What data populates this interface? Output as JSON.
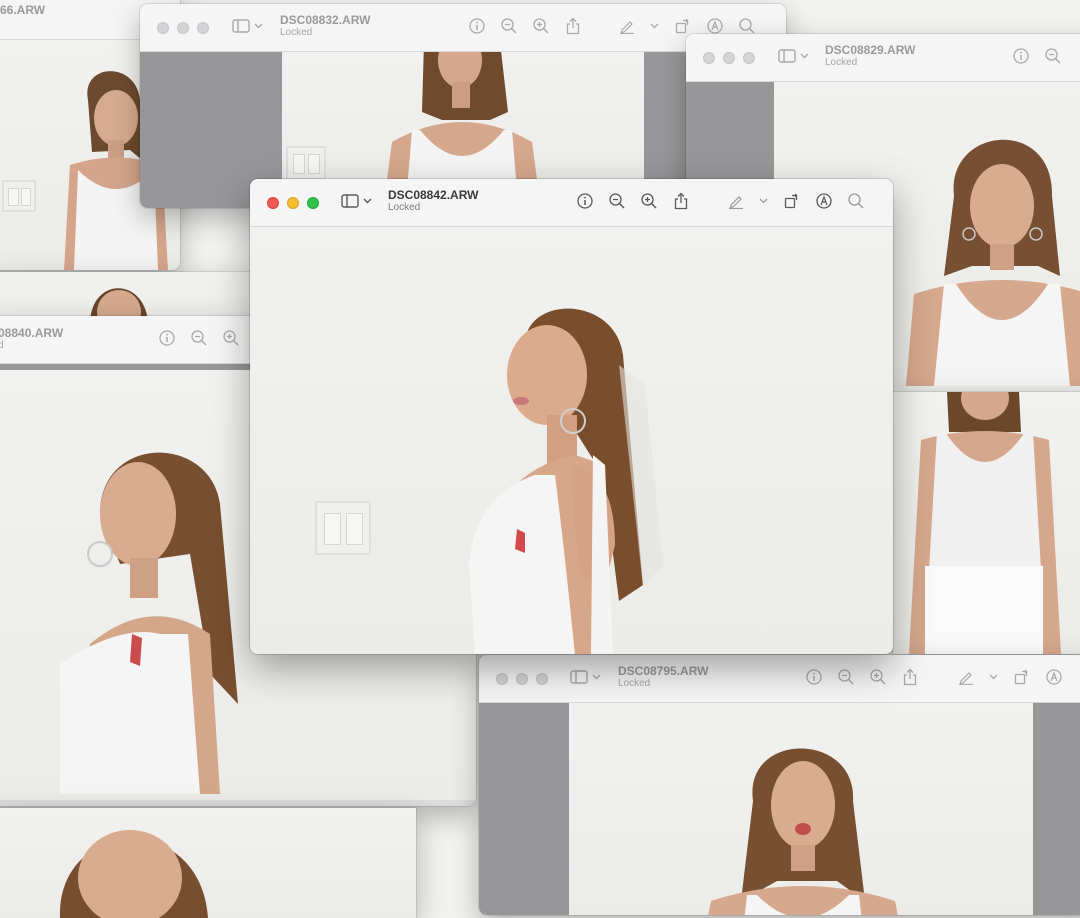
{
  "windows": [
    {
      "id": "w66",
      "title": "66.ARW",
      "subtitle": ""
    },
    {
      "id": "w832",
      "title": "DSC08832.ARW",
      "subtitle": "Locked"
    },
    {
      "id": "w829",
      "title": "DSC08829.ARW",
      "subtitle": "Locked"
    },
    {
      "id": "w840",
      "title": "08840.ARW",
      "subtitle": "d"
    },
    {
      "id": "w842",
      "title": "DSC08842.ARW",
      "subtitle": "Locked",
      "active": true
    },
    {
      "id": "w795",
      "title": "DSC08795.ARW",
      "subtitle": "Locked"
    }
  ],
  "icons": [
    "sidebar-icon",
    "chevron-down-icon",
    "info-icon",
    "zoom-out-icon",
    "zoom-in-icon",
    "share-icon",
    "markup-pen-icon",
    "rotate-icon",
    "annotate-icon",
    "search-icon"
  ],
  "colors": {
    "close": "#ee5a52",
    "minimize": "#f3be33",
    "zoom": "#31c24a",
    "toolbar": "#f5f5f6",
    "backdrop": "#979799",
    "hair": "#7a4f30",
    "skin": "#d9a98c",
    "top": "#f5f5f5"
  }
}
